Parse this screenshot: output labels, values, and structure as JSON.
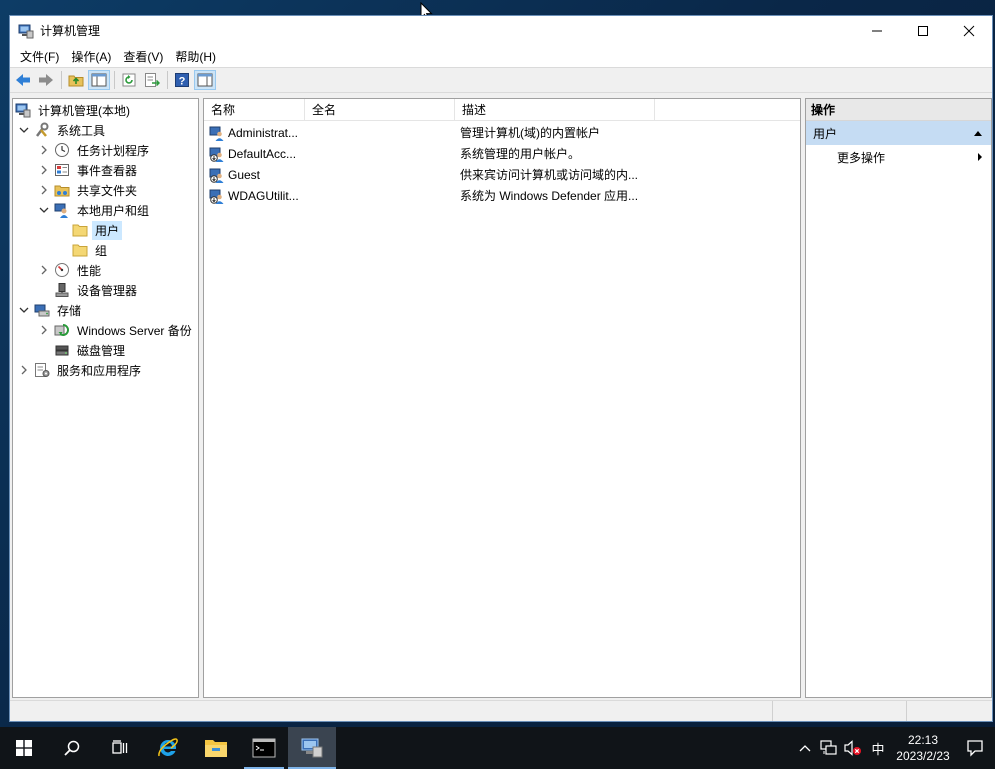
{
  "window": {
    "title": "计算机管理",
    "controls": {
      "minimize": "minimize",
      "maximize": "maximize",
      "close": "close"
    }
  },
  "menu": [
    "文件(F)",
    "操作(A)",
    "查看(V)",
    "帮助(H)"
  ],
  "toolbar": [
    "back-arrow",
    "forward-arrow",
    "up-folder",
    "show-hide-tree",
    "refresh",
    "export-list",
    "help",
    "show-hide-action-pane"
  ],
  "tree": {
    "root": "计算机管理(本地)",
    "system_tools": "系统工具",
    "task_scheduler": "任务计划程序",
    "event_viewer": "事件查看器",
    "shared_folders": "共享文件夹",
    "local_users_groups": "本地用户和组",
    "users": "用户",
    "groups": "组",
    "performance": "性能",
    "device_manager": "设备管理器",
    "storage": "存储",
    "windows_server_backup": "Windows Server 备份",
    "disk_management": "磁盘管理",
    "services_apps": "服务和应用程序"
  },
  "list": {
    "columns": [
      "名称",
      "全名",
      "描述"
    ],
    "rows": [
      {
        "name": "Administrat...",
        "fullname": "",
        "desc": "管理计算机(域)的内置帐户"
      },
      {
        "name": "DefaultAcc...",
        "fullname": "",
        "desc": "系统管理的用户帐户。"
      },
      {
        "name": "Guest",
        "fullname": "",
        "desc": "供来宾访问计算机或访问域的内..."
      },
      {
        "name": "WDAGUtilit...",
        "fullname": "",
        "desc": "系统为 Windows Defender 应用..."
      }
    ]
  },
  "actions": {
    "header": "操作",
    "section": "用户",
    "more": "更多操作"
  },
  "taskbar": {
    "ime": "中",
    "time": "22:13",
    "date": "2023/2/23"
  },
  "colors": {
    "selection": "#cce8ff",
    "action_section": "#c5dcf3",
    "taskbar": "#101418",
    "accent": "#7eb4ea"
  }
}
